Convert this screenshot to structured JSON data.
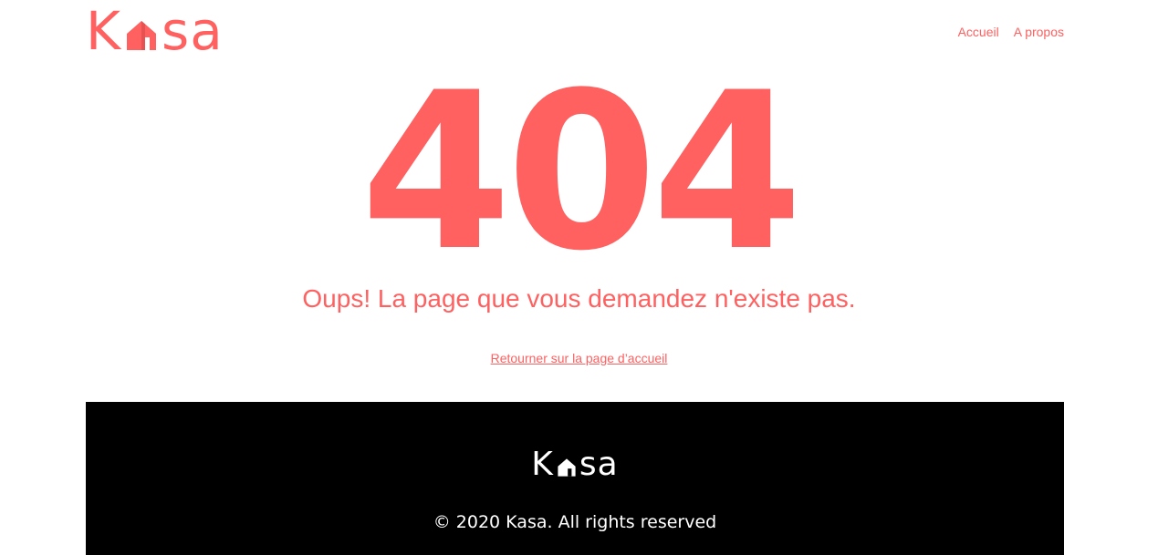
{
  "brand": {
    "logo_prefix": "K",
    "logo_suffix": "sa",
    "accent_color": "#FF6060",
    "logo_icon": "house-icon"
  },
  "nav": {
    "items": [
      {
        "label": "Accueil"
      },
      {
        "label": "A propos"
      }
    ]
  },
  "main": {
    "error_code": "404",
    "message": "Oups! La page que vous demandez n'existe pas.",
    "back_link": "Retourner sur la page d’accueil"
  },
  "footer": {
    "logo_prefix": "K",
    "logo_suffix": "sa",
    "copyright": "© 2020 Kasa. All rights reserved",
    "background_color": "#000000"
  }
}
